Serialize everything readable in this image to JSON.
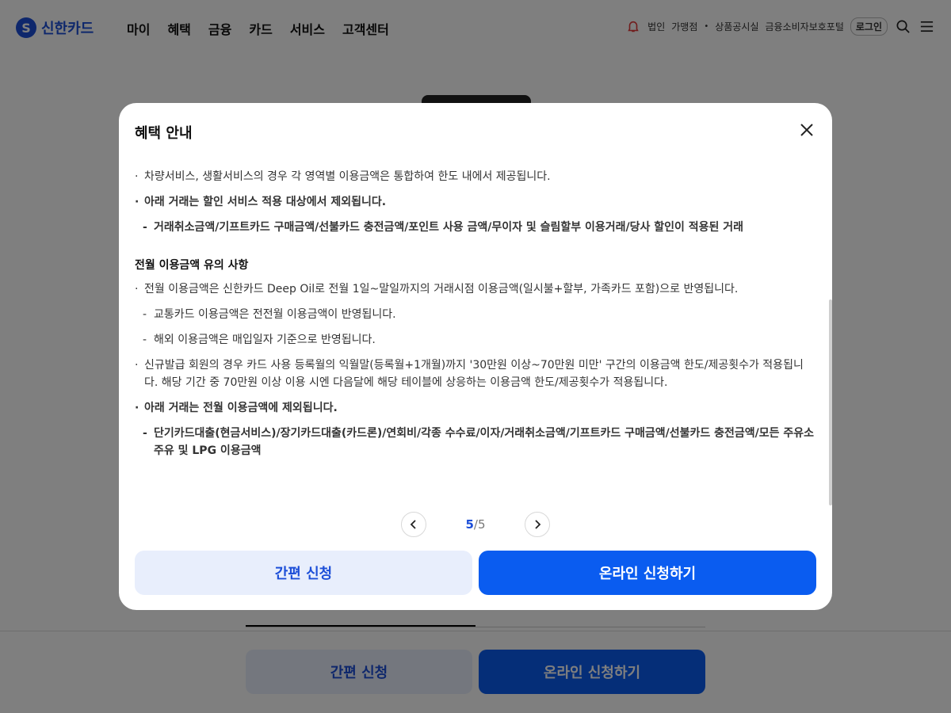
{
  "header": {
    "logo_text": "신한카드",
    "logo_mark": "S",
    "nav": [
      "마이",
      "혜택",
      "금융",
      "카드",
      "서비스",
      "고객센터"
    ],
    "util_links": [
      "법인",
      "가맹점",
      "상품공시실",
      "금융소비자보호포털"
    ],
    "login_label": "로그인",
    "icons": {
      "alert": "bell-icon",
      "search": "search-icon",
      "menu": "menu-icon"
    }
  },
  "background": {
    "tabs": [
      "",
      ""
    ],
    "simple_apply_label": "간편 신청",
    "online_apply_label": "온라인 신청하기"
  },
  "modal": {
    "title": "혜택 안내",
    "close_icon": "close-icon",
    "content": {
      "line1": "차량서비스, 생활서비스의 경우 각 영역별 이용금액은 통합하여 한도 내에서 제공됩니다.",
      "line2": "아래 거래는 할인 서비스 적용 대상에서 제외됩니다.",
      "line2_sub": "거래취소금액/기프트카드 구매금액/선불카드 충전금액/포인트 사용 금액/무이자 및 슬림할부 이용거래/당사 할인이 적용된 거래",
      "section_title": "전월 이용금액 유의 사항",
      "line3": "전월 이용금액은 신한카드 Deep Oil로 전월 1일~말일까지의 거래시점 이용금액(일시불+할부, 가족카드 포함)으로 반영됩니다.",
      "line3_sub1": "교통카드 이용금액은 전전월 이용금액이 반영됩니다.",
      "line3_sub2": "해외 이용금액은 매입일자 기준으로 반영됩니다.",
      "line4": "신규발급 회원의 경우 카드 사용 등록월의 익월말(등록월+1개월)까지 '30만원 이상~70만원 미만' 구간의 이용금액 한도/제공횟수가 적용됩니다. 해당 기간 중 70만원 이상 이용 시엔 다음달에 해당 테이블에 상응하는 이용금액 한도/제공횟수가 적용됩니다.",
      "line5": "아래 거래는 전월 이용금액에 제외됩니다.",
      "line5_sub": "단기카드대출(현금서비스)/장기카드대출(카드론)/연회비/각종 수수료/이자/거래취소금액/기프트카드 구매금액/선불카드 충전금액/모든 주유소 주유 및 LPG 이용금액"
    },
    "pager": {
      "current": "5",
      "separator": "/",
      "total": "5"
    },
    "simple_apply_label": "간편 신청",
    "online_apply_label": "온라인 신청하기"
  },
  "colors": {
    "brand": "#1d4fd8",
    "primary_button": "#0a5cf0",
    "light_button": "#e8eefc",
    "alert": "#e23a3a"
  }
}
